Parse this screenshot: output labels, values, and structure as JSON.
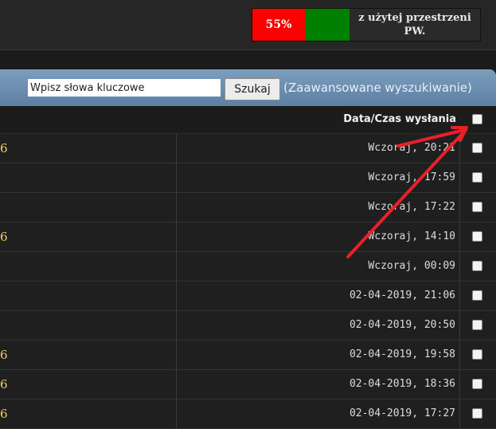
{
  "quota": {
    "percent_label": "55%",
    "text": "z użytej przestrzeni PW.",
    "used_fraction": 0.55,
    "colors": {
      "used": "#ff0000",
      "bar": "#008000"
    }
  },
  "search": {
    "input_value": "Wpisz słowa kluczowe",
    "button_label": "Szukaj",
    "advanced_label": "(Zaawansowane wyszukiwanie)"
  },
  "table": {
    "header_label": "Data/Czas wysłania",
    "rows": [
      {
        "frag": "6",
        "date": "Wczoraj, 20:21"
      },
      {
        "frag": "",
        "date": "Wczoraj, 17:59"
      },
      {
        "frag": "",
        "date": "Wczoraj, 17:22"
      },
      {
        "frag": "6",
        "date": "Wczoraj, 14:10"
      },
      {
        "frag": "",
        "date": "Wczoraj, 00:09"
      },
      {
        "frag": "",
        "date": "02-04-2019, 21:06"
      },
      {
        "frag": "",
        "date": "02-04-2019, 20:50"
      },
      {
        "frag": "6",
        "date": "02-04-2019, 19:58"
      },
      {
        "frag": "6",
        "date": "02-04-2019, 18:36"
      },
      {
        "frag": "6",
        "date": "02-04-2019, 17:27"
      }
    ]
  },
  "annotation": {
    "color": "#e8202a"
  }
}
